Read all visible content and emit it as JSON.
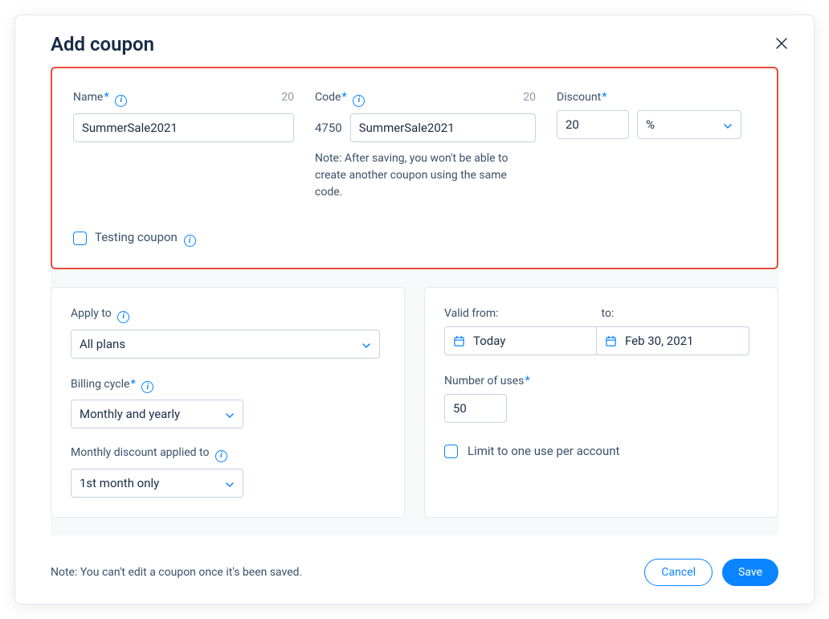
{
  "header": {
    "title": "Add coupon"
  },
  "basic": {
    "name_label": "Name",
    "name_counter": "20",
    "name_value": "SummerSale2021",
    "code_label": "Code",
    "code_counter": "20",
    "code_prefix": "4750",
    "code_value": "SummerSale2021",
    "code_note": "Note: After saving, you won't be able to create another coupon using the same code.",
    "discount_label": "Discount",
    "discount_value": "20",
    "discount_unit": "%",
    "testing_label": "Testing coupon"
  },
  "apply": {
    "apply_to_label": "Apply to",
    "apply_to_value": "All plans",
    "billing_label": "Billing cycle",
    "billing_value": "Monthly and yearly",
    "monthly_label": "Monthly discount applied to",
    "monthly_value": "1st month only"
  },
  "validity": {
    "from_label": "Valid from:",
    "to_label": "to:",
    "from_value": "Today",
    "to_value": "Feb 30, 2021",
    "uses_label": "Number of uses",
    "uses_value": "50",
    "limit_label": "Limit to one use per account"
  },
  "footer": {
    "note": "Note: You can't edit a coupon once it's been saved.",
    "cancel": "Cancel",
    "save": "Save"
  },
  "icons": {
    "info": "i"
  }
}
